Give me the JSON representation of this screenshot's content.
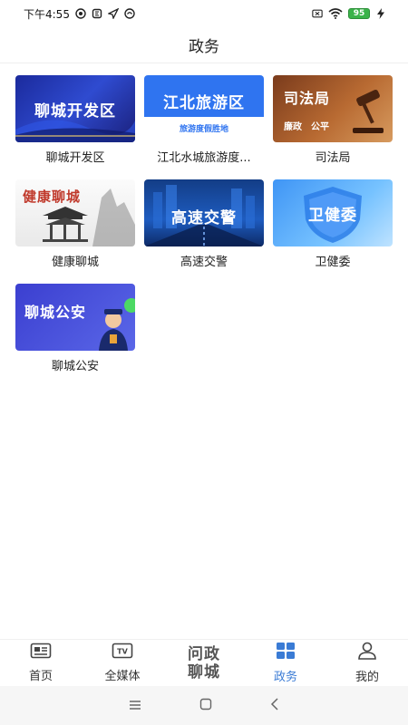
{
  "status_bar": {
    "time": "下午4:55",
    "battery": "95"
  },
  "header": {
    "title": "政务"
  },
  "tiles": [
    {
      "label": "聊城开发区",
      "thumb_text": "聊城开发区"
    },
    {
      "label": "江北水城旅游度...",
      "thumb_text": "江北旅游区",
      "thumb_sub": "旅游度假胜地"
    },
    {
      "label": "司法局",
      "thumb_text": "司法局",
      "thumb_sub": "廉政　公平"
    },
    {
      "label": "健康聊城",
      "thumb_text": "健康聊城"
    },
    {
      "label": "高速交警",
      "thumb_text": "高速交警"
    },
    {
      "label": "卫健委",
      "thumb_text": "卫健委"
    },
    {
      "label": "聊城公安",
      "thumb_text": "聊城公安"
    }
  ],
  "bottom_nav": {
    "home": "首页",
    "media": "全媒体",
    "center_line1": "问政",
    "center_line2": "聊城",
    "gov": "政务",
    "mine": "我的"
  },
  "colors": {
    "accent": "#3a7bd5"
  }
}
